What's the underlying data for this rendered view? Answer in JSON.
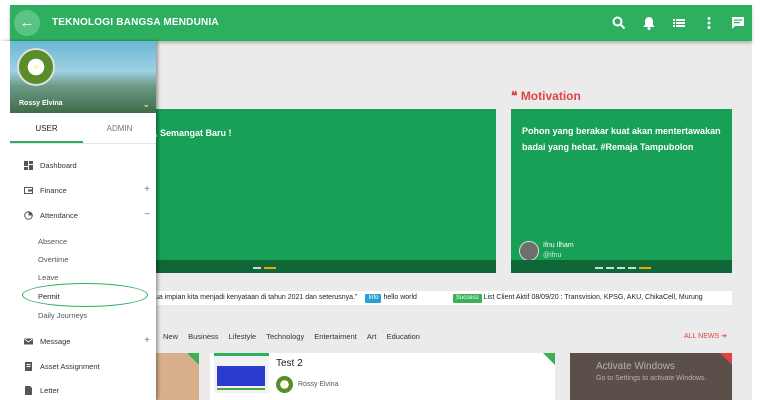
{
  "topbar": {
    "title": "TEKNOLOGI BANGSA MENDUNIA",
    "back_icon": "arrow-left-icon",
    "icons": [
      "search-icon",
      "notifications-icon",
      "list-icon",
      "more-vert-icon",
      "chat-icon"
    ]
  },
  "colors": {
    "primary": "#2eaf5f",
    "card_green": "#17a056",
    "accent_red": "#e04343",
    "dot_active": "#f0a800"
  },
  "sidebar": {
    "user_name": "Rossy Elvina",
    "tabs": [
      {
        "label": "USER",
        "active": true
      },
      {
        "label": "ADMIN",
        "active": false
      }
    ],
    "menu": [
      {
        "label": "Dashboard",
        "icon": "dashboard-icon"
      },
      {
        "label": "Finance",
        "icon": "finance-icon",
        "expand": "+"
      },
      {
        "label": "Attendance",
        "icon": "attendance-icon",
        "expand": "−"
      },
      {
        "label": "Message",
        "icon": "mail-icon",
        "expand": "+"
      },
      {
        "label": "Asset Assignment",
        "icon": "asset-icon"
      },
      {
        "label": "Letter",
        "icon": "letter-icon"
      }
    ],
    "attendance_sub": [
      "Absence",
      "Overtime",
      "Leave",
      "Permit",
      "Daily Journeys"
    ]
  },
  "cards": {
    "left_text": ", Semangat Baru !",
    "motivation_title": "Motivation",
    "motivation_text": "Pohon yang berakar kuat akan mentertawakan badai yang hebat. #Remaja Tampubolon",
    "author_name": "Ifnu Ilham",
    "author_handle": "@ifnu"
  },
  "ticker": {
    "quote_text": "ua impian kita menjadi kenyataan di tahun 2021 dan seterusnya.\"",
    "info_tag": "Info",
    "info_text": "hello world",
    "success_tag": "Success",
    "success_text": "List Client Aktif 08/09/20 : Transvision, KPSG, AKU, ChikaCell, Murung"
  },
  "categories": [
    "New",
    "Business",
    "Lifestyle",
    "Technology",
    "Entertaiment",
    "Art",
    "Education"
  ],
  "all_news_label": "ALL NEWS ➔",
  "news": {
    "title": "Test 2",
    "author": "Rossy Elvina"
  },
  "watermark": {
    "line1": "Activate Windows",
    "line2": "Go to Settings to activate Windows."
  }
}
